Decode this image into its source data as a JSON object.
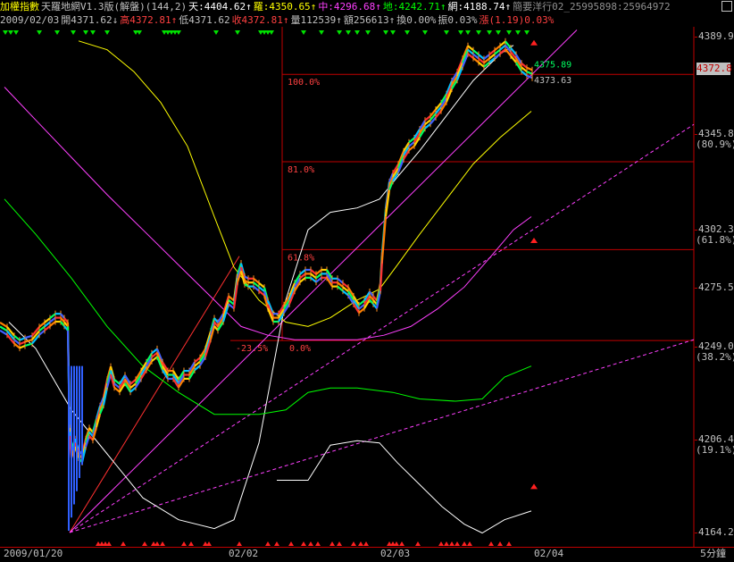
{
  "header": {
    "line1": [
      {
        "text": "加權指數",
        "color": "#ffff00"
      },
      {
        "text": "天羅地網V1.3版(解盤)(144,2)",
        "color": "#c0c0c0"
      },
      {
        "text": "天:4404.62↑",
        "color": "#ffffff"
      },
      {
        "text": "羅:4350.65↑",
        "color": "#ffff00"
      },
      {
        "text": "中:4296.68↑",
        "color": "#ff40ff"
      },
      {
        "text": "地:4242.71↑",
        "color": "#00ff00"
      },
      {
        "text": "網:4188.74↑",
        "color": "#ffffff"
      },
      {
        "text": "簡要洋行02_25995898:25964972",
        "color": "#909090"
      }
    ],
    "line2": [
      {
        "text": "2009/02/03",
        "color": "#c0c0c0"
      },
      {
        "text": "開4371.62↓",
        "color": "#c0c0c0"
      },
      {
        "text": "高4372.81↑",
        "color": "#ff4040"
      },
      {
        "text": "低4371.62",
        "color": "#c0c0c0"
      },
      {
        "text": "收4372.81↑",
        "color": "#ff4040"
      },
      {
        "text": "量112539↑",
        "color": "#c0c0c0"
      },
      {
        "text": "額256613↑",
        "color": "#c0c0c0"
      },
      {
        "text": "換0.00%",
        "color": "#c0c0c0"
      },
      {
        "text": "振0.03%",
        "color": "#c0c0c0"
      },
      {
        "text": "漲(1.19)0.03%",
        "color": "#ff4040"
      }
    ]
  },
  "axis": {
    "y_ticks": [
      {
        "value": 4389.9,
        "label": "4389.9",
        "pct": ""
      },
      {
        "value": 4345.8,
        "label": "4345.8",
        "pct": "(80.9%)"
      },
      {
        "value": 4302.3,
        "label": "4302.3",
        "pct": "(61.8%)"
      },
      {
        "value": 4275.5,
        "label": "4275.5",
        "pct": ""
      },
      {
        "value": 4249.0,
        "label": "4249.0",
        "pct": "(38.2%)"
      },
      {
        "value": 4206.4,
        "label": "4206.4",
        "pct": "(19.1%)"
      },
      {
        "value": 4164.2,
        "label": "4164.2",
        "pct": ""
      }
    ],
    "x_ticks": [
      {
        "label": "2009/01/20"
      },
      {
        "label": "02/02"
      },
      {
        "label": "02/03"
      },
      {
        "label": "02/04"
      }
    ],
    "unit": "5分鐘",
    "current_price": "4372.8"
  },
  "chart_data": {
    "type": "line",
    "title": "加權指數",
    "ylim": [
      4164.2,
      4392
    ],
    "grid": false,
    "price_series": [
      [
        0,
        4258
      ],
      [
        8,
        4256
      ],
      [
        16,
        4252
      ],
      [
        22,
        4250
      ],
      [
        28,
        4251
      ],
      [
        36,
        4252
      ],
      [
        44,
        4256
      ],
      [
        50,
        4258
      ],
      [
        56,
        4260
      ],
      [
        62,
        4262
      ],
      [
        68,
        4262
      ],
      [
        72,
        4260
      ],
      [
        76,
        4258
      ],
      [
        78,
        4210
      ],
      [
        80,
        4200
      ],
      [
        84,
        4205
      ],
      [
        88,
        4200
      ],
      [
        92,
        4198
      ],
      [
        96,
        4205
      ],
      [
        100,
        4210
      ],
      [
        104,
        4208
      ],
      [
        108,
        4214
      ],
      [
        112,
        4220
      ],
      [
        116,
        4224
      ],
      [
        120,
        4232
      ],
      [
        124,
        4238
      ],
      [
        128,
        4232
      ],
      [
        134,
        4230
      ],
      [
        140,
        4234
      ],
      [
        146,
        4230
      ],
      [
        152,
        4232
      ],
      [
        158,
        4236
      ],
      [
        164,
        4240
      ],
      [
        170,
        4244
      ],
      [
        176,
        4246
      ],
      [
        182,
        4240
      ],
      [
        188,
        4236
      ],
      [
        194,
        4236
      ],
      [
        200,
        4232
      ],
      [
        206,
        4236
      ],
      [
        212,
        4236
      ],
      [
        218,
        4240
      ],
      [
        224,
        4242
      ],
      [
        230,
        4246
      ],
      [
        236,
        4254
      ],
      [
        240,
        4260
      ],
      [
        244,
        4258
      ],
      [
        250,
        4262
      ],
      [
        256,
        4270
      ],
      [
        262,
        4268
      ],
      [
        266,
        4280
      ],
      [
        270,
        4285
      ],
      [
        274,
        4279
      ],
      [
        278,
        4278
      ],
      [
        284,
        4278
      ],
      [
        290,
        4276
      ],
      [
        296,
        4274
      ],
      [
        300,
        4268
      ],
      [
        306,
        4262
      ],
      [
        312,
        4262
      ],
      [
        318,
        4266
      ],
      [
        324,
        4270
      ],
      [
        330,
        4276
      ],
      [
        336,
        4280
      ],
      [
        342,
        4282
      ],
      [
        348,
        4282
      ],
      [
        354,
        4280
      ],
      [
        360,
        4282
      ],
      [
        366,
        4282
      ],
      [
        372,
        4278
      ],
      [
        378,
        4278
      ],
      [
        384,
        4276
      ],
      [
        390,
        4274
      ],
      [
        396,
        4270
      ],
      [
        402,
        4266
      ],
      [
        408,
        4268
      ],
      [
        414,
        4272
      ],
      [
        418,
        4270
      ],
      [
        422,
        4268
      ],
      [
        426,
        4276
      ],
      [
        428,
        4290
      ],
      [
        432,
        4310
      ],
      [
        436,
        4322
      ],
      [
        440,
        4326
      ],
      [
        446,
        4330
      ],
      [
        452,
        4336
      ],
      [
        458,
        4340
      ],
      [
        464,
        4342
      ],
      [
        470,
        4346
      ],
      [
        476,
        4350
      ],
      [
        482,
        4352
      ],
      [
        488,
        4355
      ],
      [
        494,
        4358
      ],
      [
        500,
        4362
      ],
      [
        506,
        4368
      ],
      [
        512,
        4372
      ],
      [
        518,
        4378
      ],
      [
        524,
        4384
      ],
      [
        530,
        4382
      ],
      [
        536,
        4380
      ],
      [
        542,
        4378
      ],
      [
        548,
        4380
      ],
      [
        554,
        4382
      ],
      [
        560,
        4384
      ],
      [
        566,
        4386
      ],
      [
        572,
        4383
      ],
      [
        578,
        4380
      ],
      [
        584,
        4376
      ],
      [
        590,
        4374
      ],
      [
        596,
        4373
      ]
    ],
    "series": [
      {
        "name": "天",
        "color": "#ffffff",
        "points": [
          [
            10,
            4260
          ],
          [
            40,
            4248
          ],
          [
            80,
            4220
          ],
          [
            120,
            4200
          ],
          [
            160,
            4180
          ],
          [
            200,
            4170
          ],
          [
            240,
            4166
          ],
          [
            262,
            4170
          ],
          [
            290,
            4205
          ],
          [
            320,
            4270
          ],
          [
            345,
            4302
          ],
          [
            370,
            4310
          ],
          [
            400,
            4312
          ],
          [
            425,
            4316
          ],
          [
            445,
            4326
          ],
          [
            470,
            4338
          ],
          [
            500,
            4354
          ],
          [
            530,
            4370
          ],
          [
            560,
            4382
          ],
          [
            575,
            4386
          ]
        ]
      },
      {
        "name": "羅",
        "color": "#ffff00",
        "points": [
          [
            88,
            4388
          ],
          [
            120,
            4384
          ],
          [
            150,
            4374
          ],
          [
            180,
            4360
          ],
          [
            210,
            4340
          ],
          [
            240,
            4308
          ],
          [
            262,
            4285
          ],
          [
            290,
            4270
          ],
          [
            320,
            4260
          ],
          [
            345,
            4258
          ],
          [
            370,
            4262
          ],
          [
            400,
            4270
          ],
          [
            425,
            4275
          ],
          [
            445,
            4286
          ],
          [
            470,
            4300
          ],
          [
            500,
            4316
          ],
          [
            530,
            4332
          ],
          [
            560,
            4344
          ],
          [
            595,
            4356
          ]
        ]
      },
      {
        "name": "中",
        "color": "#ff40ff",
        "points": [
          [
            5,
            4367
          ],
          [
            40,
            4352
          ],
          [
            80,
            4335
          ],
          [
            120,
            4318
          ],
          [
            160,
            4302
          ],
          [
            200,
            4286
          ],
          [
            240,
            4270
          ],
          [
            270,
            4258
          ],
          [
            300,
            4254
          ],
          [
            330,
            4252
          ],
          [
            360,
            4252
          ],
          [
            400,
            4252
          ],
          [
            430,
            4254
          ],
          [
            460,
            4258
          ],
          [
            490,
            4266
          ],
          [
            520,
            4276
          ],
          [
            550,
            4290
          ],
          [
            575,
            4302
          ],
          [
            595,
            4308
          ]
        ]
      },
      {
        "name": "地",
        "color": "#00ff00",
        "points": [
          [
            5,
            4316
          ],
          [
            40,
            4300
          ],
          [
            80,
            4280
          ],
          [
            120,
            4258
          ],
          [
            160,
            4240
          ],
          [
            200,
            4228
          ],
          [
            240,
            4218
          ],
          [
            260,
            4218
          ],
          [
            290,
            4218
          ],
          [
            320,
            4220
          ],
          [
            345,
            4228
          ],
          [
            370,
            4230
          ],
          [
            400,
            4230
          ],
          [
            440,
            4228
          ],
          [
            470,
            4225
          ],
          [
            510,
            4224
          ],
          [
            540,
            4225
          ],
          [
            565,
            4235
          ],
          [
            595,
            4240
          ]
        ]
      },
      {
        "name": "網",
        "color": "#ffffff",
        "points": [
          [
            310,
            4188
          ],
          [
            345,
            4188
          ],
          [
            370,
            4204
          ],
          [
            400,
            4206
          ],
          [
            425,
            4205
          ],
          [
            445,
            4196
          ],
          [
            470,
            4186
          ],
          [
            495,
            4176
          ],
          [
            520,
            4168
          ],
          [
            540,
            4164
          ],
          [
            565,
            4170
          ],
          [
            595,
            4174
          ]
        ]
      }
    ],
    "fib_levels": [
      {
        "label": "100.0%",
        "value": 4372.8
      },
      {
        "label": "81.0%",
        "value": 4333.0
      },
      {
        "label": "61.8%",
        "value": 4293.0
      },
      {
        "label": "0.0%",
        "value": 4251.6
      },
      {
        "label": "-23.5%",
        "value": 4251.6
      }
    ],
    "annotations": [
      {
        "label": "4375.89",
        "value": 4375.89
      },
      {
        "label": "4373.63",
        "value": 4373.63
      }
    ]
  }
}
